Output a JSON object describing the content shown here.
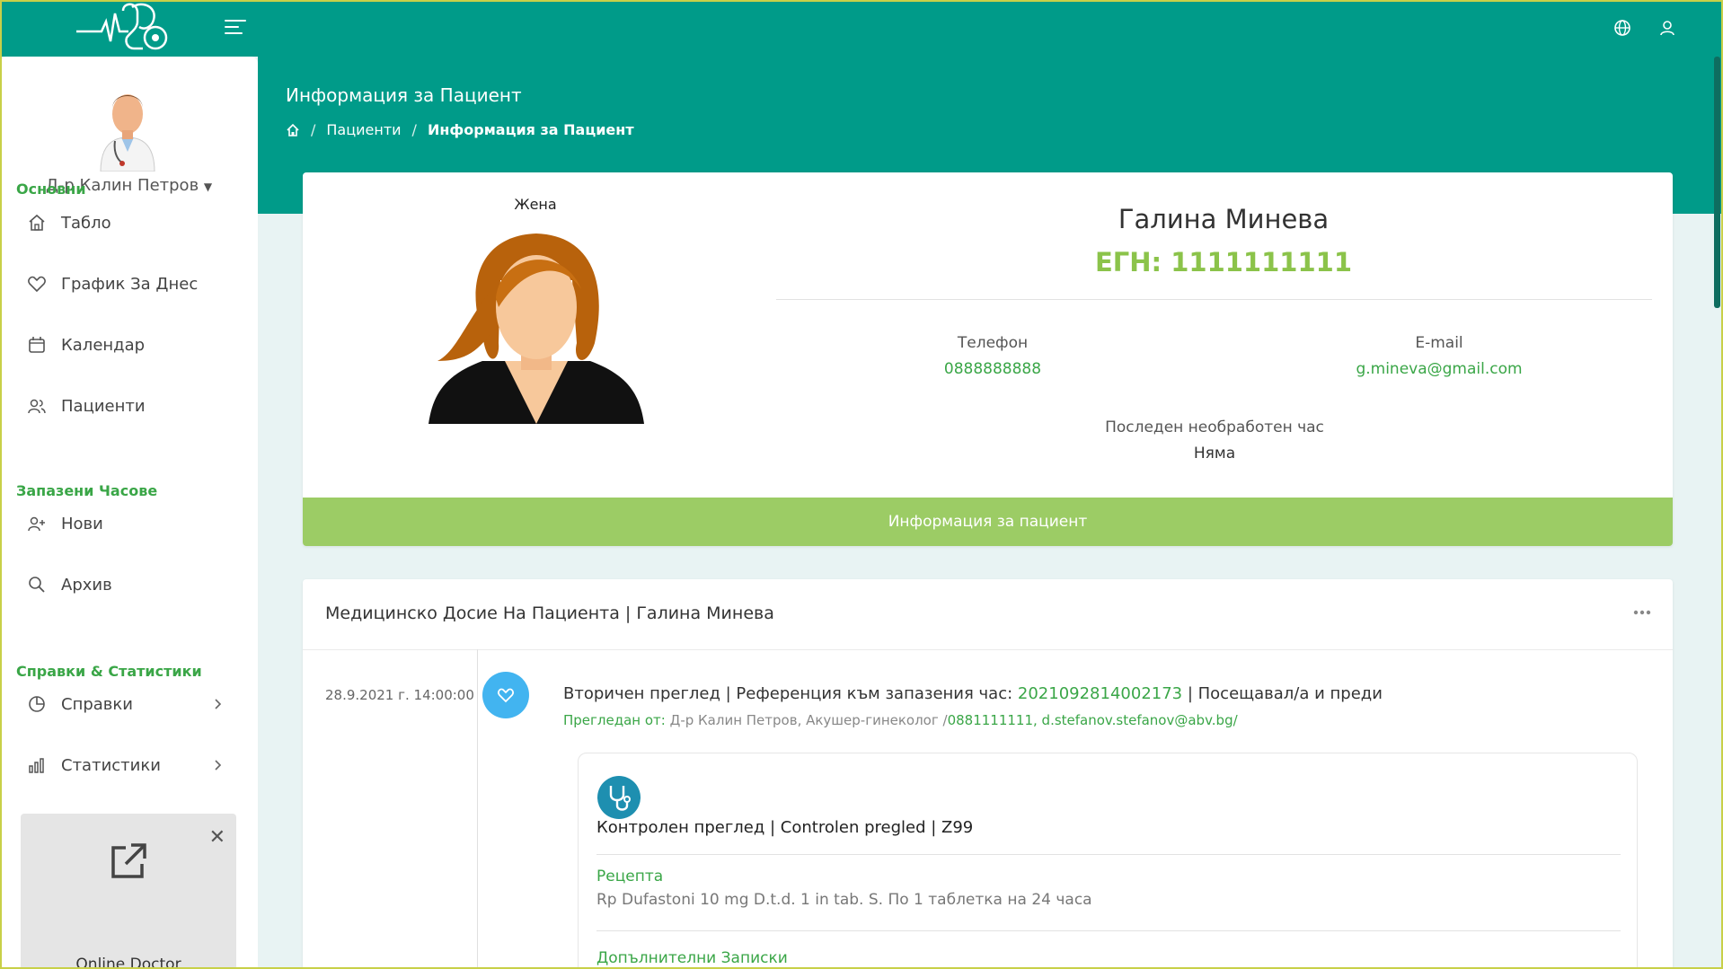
{
  "colors": {
    "primary": "#009b89",
    "accent_green": "#3aa647",
    "light_green": "#9ccc65",
    "timeline_blue": "#42b4f0"
  },
  "topbar": {
    "icons": [
      "heartbeat-stethoscope-logo",
      "menu-icon",
      "globe-icon",
      "user-icon"
    ]
  },
  "header": {
    "title": "Информация за Пациент",
    "breadcrumb": {
      "home_icon": "home-icon",
      "patients": "Пациенти",
      "sep": "/",
      "current": "Информация за Пациент"
    }
  },
  "sidebar": {
    "doctor_name": "Д-р Калин Петров",
    "sections": {
      "main": "Основни",
      "appointments": "Запазени Часове",
      "reports": "Справки & Статистики"
    },
    "items": {
      "dashboard": "Табло",
      "schedule": "График За Днес",
      "calendar": "Календар",
      "patients": "Пациенти",
      "new": "Нови",
      "archive": "Архив",
      "references": "Справки",
      "statistics": "Статистики"
    },
    "promo": {
      "label": "Online Doctor",
      "close": "✕"
    }
  },
  "patient": {
    "gender": "Жена",
    "name": "Галина Минева",
    "egn": "ЕГН: 1111111111",
    "phone_label": "Телефон",
    "phone": "0888888888",
    "email_label": "E-mail",
    "email": "g.mineva@gmail.com",
    "last_label": "Последен необработен час",
    "last_value": "Няма",
    "info_button": "Информация за пациент"
  },
  "record": {
    "title": "Медицинско Досие На Пациента | Галина Минева",
    "entry": {
      "date": "28.9.2021 г. 14:00:00",
      "title_prefix": "Вторичен преглед | Референция към запазения час: ",
      "reference": "2021092814002173",
      "title_suffix": " | Посещавал/а и преди",
      "sub_prefix": "Прегледан от: ",
      "doctor": "Д-р Калин Петров, Акушер-гинеколог /",
      "phone": "0881111111",
      "sep": ", ",
      "email": "d.stefanov.stefanov@abv.bg/",
      "exam_title": "Контролен преглед | Controlen pregled | Z99",
      "rx_label": "Рецепта",
      "rx_text": "Rp Dufastoni 10 mg D.t.d. 1 in tab. S. По 1 таблетка на 24 часа",
      "notes_label": "Допълнителни Записки"
    }
  }
}
